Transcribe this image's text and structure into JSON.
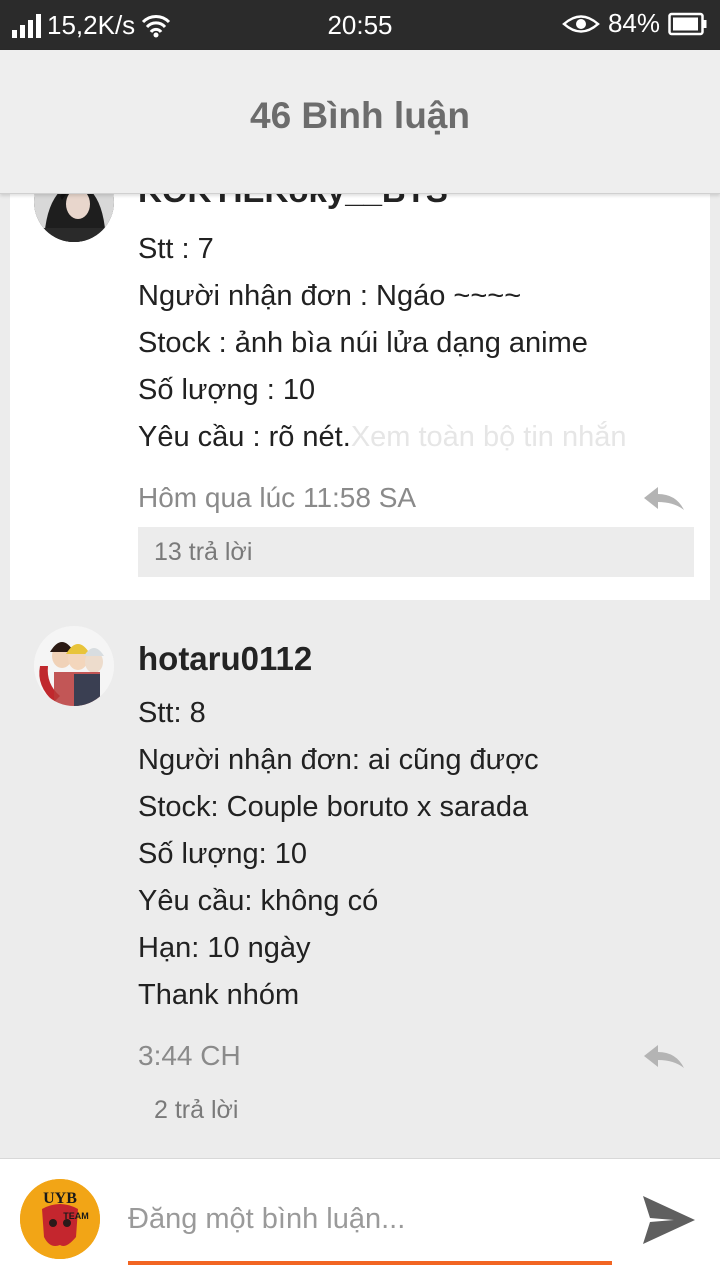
{
  "status_bar": {
    "speed": "15,2K/s",
    "time": "20:55",
    "battery": "84%"
  },
  "header": {
    "title": "46 Bình luận"
  },
  "comments": [
    {
      "username": "KOKYIEKoky__BTS",
      "lines": [
        "Stt : 7",
        "Người nhận đơn : Ngáo ~~~~",
        "Stock : ảnh bìa núi lửa dạng anime",
        "Số lượng : 10",
        "Yêu cầu : rõ nét."
      ],
      "see_more": "Xem toàn bộ tin nhắn",
      "time": "Hôm qua lúc 11:58 SA",
      "replies": "13 trả lời"
    },
    {
      "username": "hotaru0112",
      "lines": [
        "Stt: 8",
        "Người nhận đơn: ai cũng được",
        "Stock: Couple boruto x sarada",
        "Số lượng: 10",
        "Yêu cầu: không có",
        "Hạn: 10 ngày",
        "Thank nhóm"
      ],
      "time": "3:44 CH",
      "replies": "2 trả lời"
    }
  ],
  "input": {
    "placeholder": "Đăng một bình luận...",
    "avatar_text": "UYB",
    "avatar_subtext": "TEAM"
  },
  "colors": {
    "accent": "#f26522",
    "status_bar": "#2b2b2b",
    "header_bg": "#eeeeee"
  },
  "icons": [
    "signal-icon",
    "wifi-icon",
    "eye-icon",
    "battery-icon",
    "reply-icon",
    "send-icon"
  ]
}
